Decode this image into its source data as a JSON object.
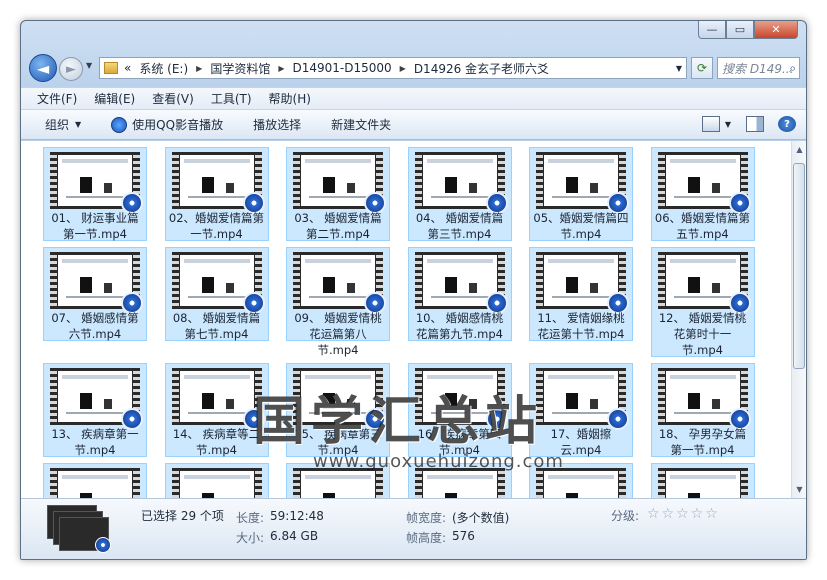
{
  "window": {
    "min_label": "—",
    "max_label": "▭",
    "close_label": "✕"
  },
  "address": {
    "chevrons": "«",
    "segments": [
      "系统 (E:)",
      "国学资料馆",
      "D14901-D15000",
      "D14926 金玄子老师六爻"
    ],
    "search_placeholder": "搜索 D149..."
  },
  "menu": [
    "文件(F)",
    "编辑(E)",
    "查看(V)",
    "工具(T)",
    "帮助(H)"
  ],
  "toolbar": {
    "organize": "组织",
    "qq_play": "使用QQ影音播放",
    "play_select": "播放选择",
    "new_folder": "新建文件夹"
  },
  "files": [
    {
      "label": "01、 财运事业篇第一节.mp4"
    },
    {
      "label": "02、婚姻爱情篇第一节.mp4"
    },
    {
      "label": "03、 婚姻爱情篇第二节.mp4"
    },
    {
      "label": "04、 婚姻爱情篇第三节.mp4"
    },
    {
      "label": "05、婚姻爱情篇四节.mp4"
    },
    {
      "label": "06、婚姻爱情篇第五节.mp4"
    },
    {
      "label": "07、 婚姻感情第六节.mp4"
    },
    {
      "label": "08、 婚姻爱情篇第七节.mp4"
    },
    {
      "label": "09、 婚姻爱情桃花运篇第八节.mp4"
    },
    {
      "label": "10、 婚姻感情桃花篇第九节.mp4"
    },
    {
      "label": "11、 爱情姻缘桃花运第十节.mp4"
    },
    {
      "label": "12、 婚姻爱情桃花第时十一节.mp4"
    },
    {
      "label": "13、 疾病章第一节.mp4"
    },
    {
      "label": "14、 疾病章等二节.mp4"
    },
    {
      "label": "15、 疾病章第三节.mp4"
    },
    {
      "label": "16、疾病章第四节.mp4"
    },
    {
      "label": "17、婚姻擦云.mp4"
    },
    {
      "label": "18、 孕男孕女篇第一节.mp4"
    },
    {
      "label": ""
    },
    {
      "label": ""
    },
    {
      "label": ""
    },
    {
      "label": ""
    },
    {
      "label": ""
    },
    {
      "label": ""
    }
  ],
  "watermark": {
    "main": "国学汇总站",
    "sub": "www.guoxuehuizong.com"
  },
  "details": {
    "selected": "已选择 29 个项",
    "length_label": "长度:",
    "length_value": "59:12:48",
    "size_label": "大小:",
    "size_value": "6.84 GB",
    "frame_width_label": "帧宽度:",
    "frame_width_value": "(多个数值)",
    "frame_height_label": "帧高度:",
    "frame_height_value": "576",
    "rating_label": "分级:",
    "rating_stars": "☆☆☆☆☆"
  }
}
